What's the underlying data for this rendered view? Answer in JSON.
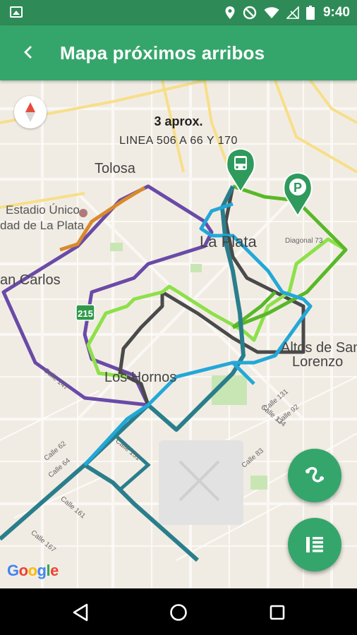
{
  "status_bar": {
    "time": "9:40",
    "icons": [
      "image-icon",
      "location-icon",
      "do-not-disturb-icon",
      "wifi-icon",
      "no-signal-icon",
      "battery-icon"
    ]
  },
  "app_bar": {
    "title": "Mapa próximos arribos",
    "back_icon": "back-arrow-icon"
  },
  "map": {
    "bus_info": {
      "title": "3 aprox.",
      "line": "LINEA 506 A 66 Y 170"
    },
    "labels": {
      "tolosa": "Tolosa",
      "estadio_1": "Estadio Único",
      "estadio_2": "dad de La Plata",
      "la_plata": "La Plata",
      "san_carlos": "an Carlos",
      "altos_1": "Altos de San",
      "altos_2": "Lorenzo",
      "los_hornos": "Los Hornos",
      "diagonal": "Diagonal 73",
      "route_215": "215",
      "calle_151": "Calle 151",
      "calle_62": "Calle 62",
      "calle_64": "Calle 64",
      "calle_161": "Calle 161",
      "calle_167": "Calle 167",
      "calle_147": "Calle 147",
      "calle_83": "Calle 83",
      "calle_131": "Calle 131",
      "calle_134": "Calle 134",
      "calle_92": "Calle 92"
    },
    "markers": [
      "bus-stop-marker-icon",
      "parking-marker-icon"
    ],
    "route_colors": {
      "purple": "#6a4aa8",
      "orange": "#d88a2c",
      "green": "#58b828",
      "light_green": "#8de04a",
      "teal": "#2a7e8c",
      "light_blue": "#22a8d8",
      "dark_gray": "#4a4a4a"
    }
  },
  "attribution": "Google",
  "fab": {
    "route_icon": "route-icon",
    "list_icon": "schedule-list-icon"
  },
  "theme": {
    "primary": "#35a66b",
    "status_bar": "#2e8b57"
  }
}
